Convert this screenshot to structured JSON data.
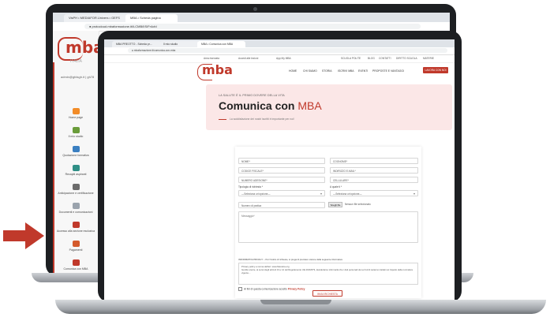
{
  "back_browser": {
    "tab1": "VisPH • MEDIAFOR.Univers • GEFS",
    "tab2": "MBA • Scheda pagina",
    "url": "● protocloud.mbaformazione.it/il-CMB/IIS/Fr4cfd",
    "logo": "mba",
    "logo_sub": "ITALIA",
    "user_line": "admin@gfdsgh.it | gh78",
    "sidebar": [
      {
        "label": "Home page",
        "color": "#f28c28"
      },
      {
        "label": "Il mio studio",
        "color": "#6a9c3a"
      },
      {
        "label": "Quotazione formativa",
        "color": "#3a7fc1"
      },
      {
        "label": "Recapiti aspiranti",
        "color": "#2f8f86"
      },
      {
        "label": "Anticipazione e certificazione",
        "color": "#6b6b6b"
      },
      {
        "label": "Documenti e comunicazioni",
        "color": "#9aa3ad"
      },
      {
        "label": "Accesso alla sezione esclusiva",
        "color": "#c0392b"
      },
      {
        "label": "Pagamenti",
        "color": "#d45a2c"
      },
      {
        "label": "Comunica con MBA",
        "color": "#c0392b"
      }
    ]
  },
  "front_browser": {
    "tab1": "MBA PREOTTO - Scheda pr...",
    "tab2": "Il mio studio",
    "tab3": "MBA • Comunica con MBA",
    "url": "● mbaformazione.it/comunica-con-mba",
    "topbar": {
      "left1": "Area riservata",
      "left2": "Accedi alle lezioni",
      "left3": "App My MBA",
      "right1": "SCUOLA POLITE",
      "right2": "BLOG",
      "right3": "CONTATTI",
      "right4": "DIRITTO SCUOLA",
      "right5": "MATERIE"
    },
    "nav": {
      "logo": "mba",
      "items": [
        "HOME",
        "CHI SIAMO",
        "STORIA",
        "ISCRIVI MBA",
        "EVENTI",
        "PROPOSTE E VANTAGGI"
      ],
      "cta": "LAVORA CON NOI"
    },
    "hero": {
      "kicker": "LA SALUTE È IL PRIMO DOVERE DELLA VITA",
      "title_main": "Comunica con",
      "title_accent": "MBA",
      "subtitle": "La soddisfazione dei nostri iscritti è importante per noi!"
    },
    "form": {
      "nome": "NOME*",
      "cognome": "COGNOME*",
      "codice_fiscale": "CODICE FISCALE*",
      "email": "INDIRIZZO E-MAIL*",
      "numero_adesione": "NUMERO ADESIONE*",
      "cellulare": "CELLULARE*",
      "tipologia_label": "Tipologia di richiesta *",
      "tipologia_value": "—Seleziona un'opzione—",
      "quale_label": "A quale ti *",
      "quale_value": "—Seleziona un'opzione—",
      "numero_pratica": "Numero di pratica",
      "file_button": "Scegli file",
      "file_status": "Nessun file selezionato",
      "messaggio": "Messaggio*",
      "privacy_title": "INFORMATIVA PRIVACY – Per l'inoltro di richieste, si prega di prendere visione della seguente informativa",
      "privacy_text1": "Privacy policy a norma dell'art. www.Messina.org",
      "privacy_text2": "Gentile utente, ai sensi degli articoli 13 e 14 del Regolamento UE 2016/679, desideriamo informarla che i dati personali da Lei forniti saranno trattati nel rispetto della normativa vigente...",
      "consent_prefix": "Ai fini di questa comunicazione accetto",
      "consent_link": "Privacy Policy",
      "send": "INVIA RICHIESTA"
    }
  },
  "arrow_color": "#c0392b"
}
